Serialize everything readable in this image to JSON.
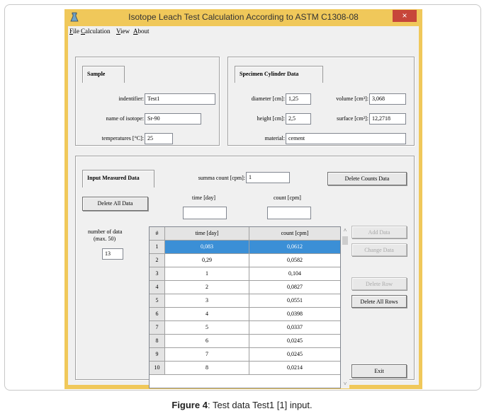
{
  "window": {
    "title": "Isotope Leach Test Calculation According to ASTM C1308-08",
    "close_glyph": "×"
  },
  "menu": [
    {
      "pre": "",
      "mnem": "F",
      "post": "ile"
    },
    {
      "pre": "",
      "mnem": "C",
      "post": "alculation"
    },
    {
      "pre": "",
      "mnem": "V",
      "post": "iew"
    },
    {
      "pre": "",
      "mnem": "A",
      "post": "bout"
    }
  ],
  "sample": {
    "tab": "Sample",
    "identifier_label": "indentifier:",
    "identifier_value": "Test1",
    "isotope_label": "name of isotope:",
    "isotope_value": "Sr-90",
    "temperature_label": "temperatures [°C]:",
    "temperature_value": "25"
  },
  "specimen": {
    "tab": "Specimen Cylinder Data",
    "diameter_label": "diameter [cm]:",
    "diameter_value": "1,25",
    "volume_label": "volume [cm³]:",
    "volume_value": "3,068",
    "height_label": "height [cm]:",
    "height_value": "2,5",
    "surface_label": "surface [cm²]:",
    "surface_value": "12,2718",
    "material_label": "material:",
    "material_value": "cement"
  },
  "measured": {
    "tab": "Input Measured Data",
    "summa_label": "summa count [cpm]:",
    "summa_value": "1",
    "delete_counts_button": "Delete Counts Data",
    "delete_all_button": "Delete All Data",
    "time_label": "time [day]",
    "time_value": "",
    "count_label": "count [cpm]",
    "count_value": "",
    "number_label_1": "number of data",
    "number_label_2": "(max. 50)",
    "number_value": "13"
  },
  "table": {
    "headers": [
      "#",
      "time [day]",
      "count [cpm]"
    ],
    "rows": [
      [
        "1",
        "0,083",
        "0,0612"
      ],
      [
        "2",
        "0,29",
        "0,0582"
      ],
      [
        "3",
        "1",
        "0,104"
      ],
      [
        "4",
        "2",
        "0,0827"
      ],
      [
        "5",
        "3",
        "0,0551"
      ],
      [
        "6",
        "4",
        "0,0398"
      ],
      [
        "7",
        "5",
        "0,0337"
      ],
      [
        "8",
        "6",
        "0,0245"
      ],
      [
        "9",
        "7",
        "0,0245"
      ],
      [
        "10",
        "8",
        "0,0214"
      ]
    ],
    "selected_row": 1
  },
  "buttons": {
    "add_data": "Add Data",
    "change_data": "Change Data",
    "delete_row": "Delete Row",
    "delete_all_rows": "Delete All Rows",
    "exit": "Exit"
  },
  "caption": {
    "label": "Figure 4",
    "text": ": Test data Test1 [1] input."
  },
  "colors": {
    "title_bar": "#f0c85a",
    "close_button": "#c7463a",
    "selection": "#3b8fd6",
    "panel": "#f0f0f0"
  }
}
